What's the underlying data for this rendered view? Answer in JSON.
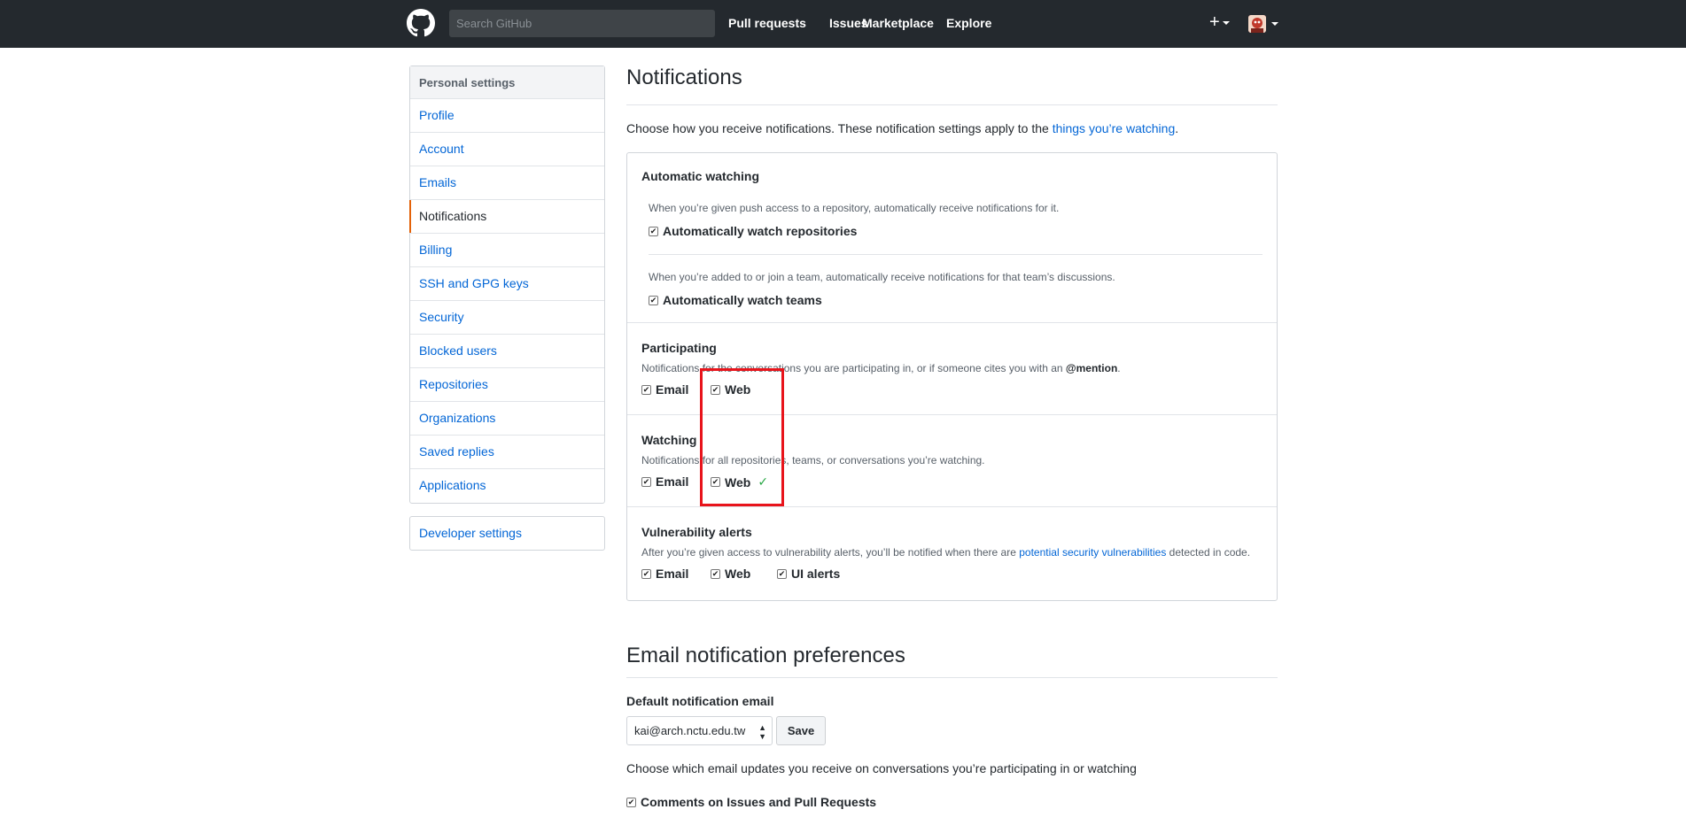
{
  "header": {
    "search_placeholder": "Search GitHub",
    "nav": [
      "Pull requests",
      "Issues",
      "Marketplace",
      "Explore"
    ],
    "plus_label": "+"
  },
  "sidebar": {
    "heading": "Personal settings",
    "items": [
      {
        "label": "Profile"
      },
      {
        "label": "Account"
      },
      {
        "label": "Emails"
      },
      {
        "label": "Notifications",
        "selected": true
      },
      {
        "label": "Billing"
      },
      {
        "label": "SSH and GPG keys"
      },
      {
        "label": "Security"
      },
      {
        "label": "Blocked users"
      },
      {
        "label": "Repositories"
      },
      {
        "label": "Organizations"
      },
      {
        "label": "Saved replies"
      },
      {
        "label": "Applications"
      }
    ],
    "developer": "Developer settings"
  },
  "main": {
    "title": "Notifications",
    "intro_prefix": "Choose how you receive notifications. These notification settings apply to the ",
    "intro_link": "things you’re watching",
    "intro_suffix": ".",
    "auto": {
      "title": "Automatic watching",
      "note_repo": "When you’re given push access to a repository, automatically receive notifications for it.",
      "cb_repo": "Automatically watch repositories",
      "note_team": "When you’re added to or join a team, automatically receive notifications for that team’s discussions.",
      "cb_team": "Automatically watch teams"
    },
    "participating": {
      "title": "Participating",
      "note": "Notifications for the conversations you are participating in, or if someone cites you with an ",
      "mention": "@mention",
      "email": "Email",
      "web": "Web"
    },
    "watching": {
      "title": "Watching",
      "note": "Notifications for all repositories, teams, or conversations you’re watching.",
      "email": "Email",
      "web": "Web",
      "saved_check": "✓"
    },
    "vuln": {
      "title": "Vulnerability alerts",
      "note_prefix": "After you’re given access to vulnerability alerts, you’ll be notified when there are ",
      "note_link": "potential security vulnerabilities",
      "note_suffix": " detected in code.",
      "email": "Email",
      "web": "Web",
      "ui": "UI alerts"
    },
    "email_prefs": {
      "title": "Email notification preferences",
      "default_label": "Default notification email",
      "selected_email": "kai@arch.nctu.edu.tw",
      "save": "Save",
      "choose": "Choose which email updates you receive on conversations you’re participating in or watching",
      "comments": "Comments on Issues and Pull Requests"
    }
  },
  "colors": {
    "header_bg": "#24292e",
    "link": "#0366d6",
    "selected_accent": "#e36209",
    "highlight": "#e8141b",
    "check": "#28a745"
  }
}
